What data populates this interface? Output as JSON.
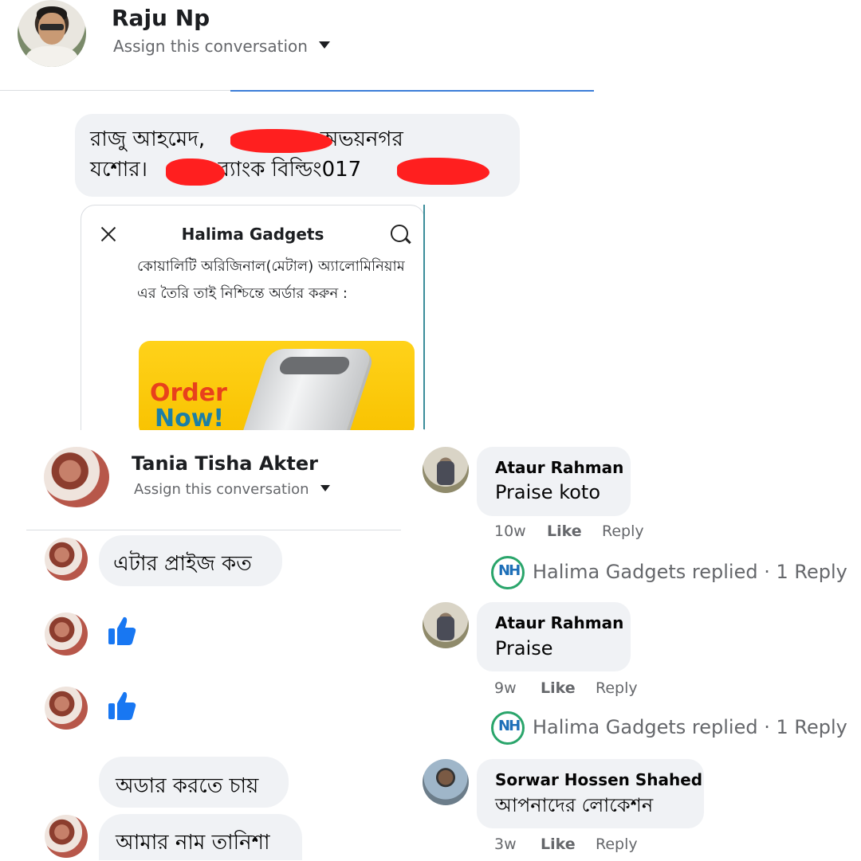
{
  "top": {
    "contact_name": "Raju Np",
    "assign_label": "Assign this conversation",
    "message_line1": "রাজু আহমেদ, ",
    "message_line1b": " অভয়নগর",
    "message_line2": "যশোর। ",
    "message_line2b": " ব্যাংক বিল্ডিং017"
  },
  "card": {
    "title": "Halima Gadgets",
    "description": "কোয়ালিটি অরিজিনাল(মেটাল) অ্যালোমিনিয়াম এর তৈরি তাই নিশ্চিন্তে অর্ডার করুন :",
    "promo_line1": "Order",
    "promo_line2": "Now!"
  },
  "left": {
    "contact_name": "Tania Tisha Akter",
    "assign_label": "Assign this conversation",
    "messages": [
      "এটার প্রাইজ কত",
      "অডার করতে চায়",
      "আমার নাম তানিশা"
    ]
  },
  "comments": [
    {
      "author": "Ataur Rahman",
      "text": "Praise koto",
      "time": "10w",
      "like": "Like",
      "reply": "Reply",
      "replied": "Halima Gadgets replied · 1 Reply"
    },
    {
      "author": "Ataur Rahman",
      "text": "Praise",
      "time": "9w",
      "like": "Like",
      "reply": "Reply",
      "replied": "Halima Gadgets replied · 1 Reply"
    },
    {
      "author": "Sorwar Hossen Shahed",
      "text": "আপনাদের লোকেশন",
      "time": "3w",
      "like": "Like",
      "reply": "Reply"
    }
  ],
  "icons": {
    "close": "close-icon",
    "search": "search-icon",
    "like": "thumbs-up-icon",
    "dropdown": "chevron-down-icon",
    "page_logo": "halima-gadgets-logo"
  },
  "colors": {
    "like_blue": "#1877f2",
    "bubble_grey": "#f0f2f5",
    "redaction_red": "#ff1f1f",
    "promo_yellow": "#ffd21a"
  }
}
